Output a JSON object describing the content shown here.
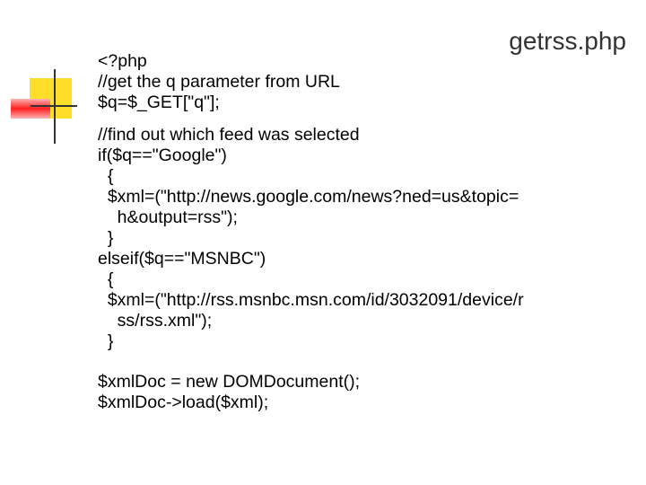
{
  "slide": {
    "title": "getrss.php",
    "code_lines": [
      "<?php",
      "//get the q parameter from URL",
      "$q=$_GET[\"q\"];",
      "//find out which feed was selected",
      "if($q==\"Google\")",
      "  {",
      "  $xml=(\"http://news.google.com/news?ned=us&topic=",
      "    h&output=rss\");",
      "  }",
      "elseif($q==\"MSNBC\")",
      "  {",
      "  $xml=(\"http://rss.msnbc.msn.com/id/3032091/device/r",
      "    ss/rss.xml\");",
      "  }",
      "$xmlDoc = new DOMDocument();",
      "$xmlDoc->load($xml);"
    ]
  }
}
